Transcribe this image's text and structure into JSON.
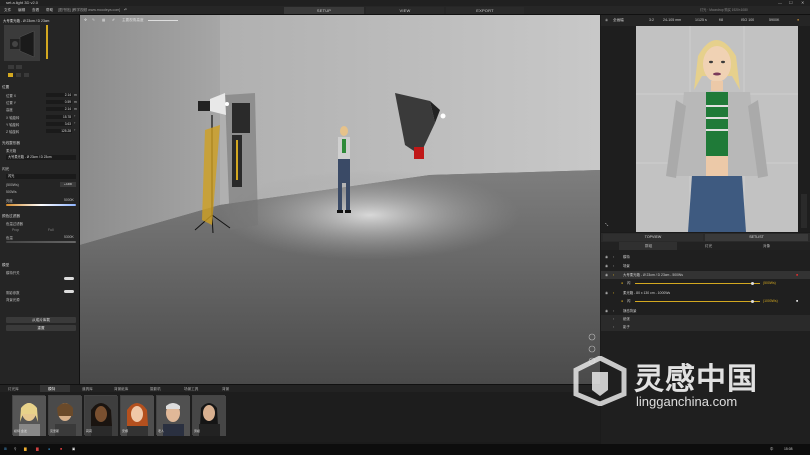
{
  "window": {
    "title": "set.a.light 3D v2.0",
    "controls": [
      "—",
      "☐",
      "✕"
    ]
  },
  "menubar": {
    "items": [
      "文件",
      "编辑",
      "查看",
      "帮助"
    ],
    "info": "[图书馆] [教学视频 www.moodeya.com]",
    "right_info": "灯光 · Moondrop 购买 1920×1080"
  },
  "modes": {
    "setup": "SETUP",
    "view": "VIEW",
    "export": "EXPORT"
  },
  "viewport_toolbar": {
    "slider_label": "主要视角高度"
  },
  "left_panel": {
    "title": "大号柔光箱 - Ø 23cm / D 23cm",
    "position_header": "位置",
    "params": [
      {
        "label": "位置 X",
        "value": "2.14",
        "unit": "m"
      },
      {
        "label": "位置 Y",
        "value": "0.59",
        "unit": "m"
      },
      {
        "label": "高度",
        "value": "2.14",
        "unit": "m"
      },
      {
        "label": "X 轴旋转",
        "value": "15.78",
        "unit": "°"
      },
      {
        "label": "Y 轴旋转",
        "value": "3.63",
        "unit": "°"
      },
      {
        "label": "Z 轴旋转",
        "value": "125.28",
        "unit": "°"
      }
    ],
    "lightshaper_header": "光线整形器",
    "lightshaper_sub": "柔光箱",
    "lightshaper_select": "大号柔光箱 - Ø 23cm / D 23cm",
    "flash_header": "闪光",
    "flash_select": "闪光",
    "power_value": "(500Ws)",
    "add_label": "ADD",
    "power_sub": "500Ws",
    "mix_label": "亮度",
    "mix_value": "5000K",
    "filter_header": "颜色过滤器",
    "filter_label": "色温过滤器",
    "filter_left": "Prop",
    "filter_right": "Full",
    "temp_label": "色温",
    "temp_value": "5300K",
    "model_header": "模型",
    "model_label": "模特开关",
    "gel_label": "阴影参数",
    "gel_sub": "背景光源",
    "btn_library": "从成片库载",
    "btn_reset": "重置"
  },
  "library": {
    "tabs": [
      "灯光库",
      "模特",
      "道具库",
      "背景纸库",
      "摄影机",
      "场景工具",
      "背景"
    ],
    "models": [
      {
        "name": "模特 金发"
      },
      {
        "name": "克里斯"
      },
      {
        "name": "莉莉"
      },
      {
        "name": "安娜"
      },
      {
        "name": "老人"
      },
      {
        "name": "男模"
      }
    ]
  },
  "taskbar": {
    "time": "15:08",
    "lang": "中"
  },
  "right_panel": {
    "camera_bar": {
      "camera": "全画幅",
      "ratio": "3:2",
      "lens": "24-105 mm",
      "shutter": "1/125 s",
      "aperture": "f/8",
      "iso": "ISO 100",
      "wb": "5900K"
    },
    "tabs": {
      "topview": "TOPVIEW",
      "setlist": "SETLIST"
    },
    "subtabs": [
      "群组",
      "灯光",
      "对象"
    ],
    "scene": [
      {
        "label": "模特"
      },
      {
        "label": "场景"
      },
      {
        "label": "大号柔光箱 - Ø 23cm / D 23cm - 500Ws"
      },
      {
        "label": "闪",
        "power": "(500Ws)"
      },
      {
        "label": "柔光箱 - 80 x 130 cm - 1000Ws"
      },
      {
        "label": "闪",
        "power": "(1000Ws)"
      },
      {
        "label": "静态背景"
      },
      {
        "label": "纸张"
      },
      {
        "label": "影子"
      }
    ]
  },
  "watermark": {
    "text": "灵感中国",
    "url": "lingganchina.com"
  }
}
